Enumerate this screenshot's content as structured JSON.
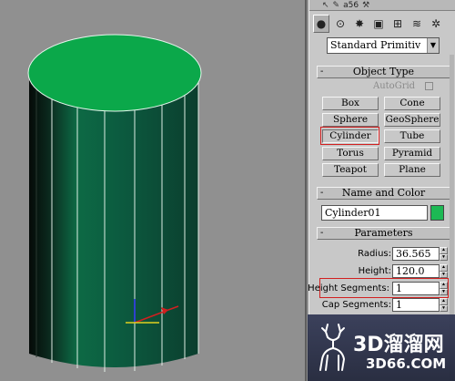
{
  "top_strip": {
    "tab_text": "a56"
  },
  "category_dropdown": {
    "selected": "Standard Primitiv"
  },
  "object_type": {
    "title": "Object Type",
    "autogrid_label": "AutoGrid",
    "buttons": [
      {
        "label": "Box"
      },
      {
        "label": "Cone"
      },
      {
        "label": "Sphere"
      },
      {
        "label": "GeoSphere"
      },
      {
        "label": "Cylinder",
        "active": true
      },
      {
        "label": "Tube"
      },
      {
        "label": "Torus"
      },
      {
        "label": "Pyramid"
      },
      {
        "label": "Teapot"
      },
      {
        "label": "Plane"
      }
    ]
  },
  "name_color": {
    "title": "Name and Color",
    "object_name": "Cylinder01",
    "color": "#1db954"
  },
  "parameters": {
    "title": "Parameters",
    "radius_label": "Radius:",
    "radius_value": "36.565",
    "height_label": "Height:",
    "height_value": "120.0",
    "height_segments_label": "Height Segments:",
    "height_segments_value": "1",
    "cap_segments_label": "Cap Segments:",
    "cap_segments_value": "1"
  },
  "rollout_sign": "-",
  "watermark": {
    "title": "3D溜溜网",
    "subtitle": "3D66.COM"
  },
  "colors": {
    "cylinder_cap": "#0ba84a",
    "cylinder_side": "#0a5a3e",
    "highlight": "#d22020"
  }
}
